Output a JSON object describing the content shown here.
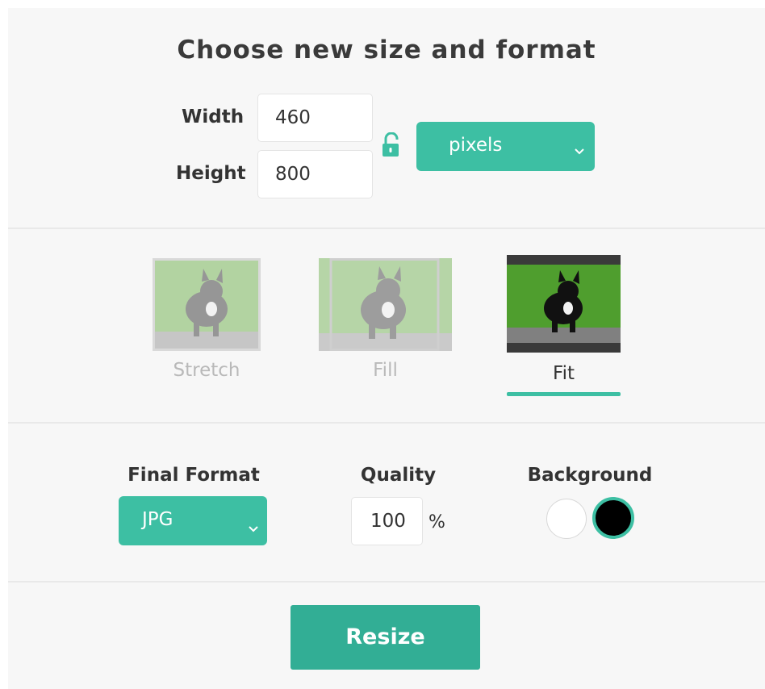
{
  "header": {
    "title": "Choose new size and format"
  },
  "dimensions": {
    "width_label": "Width",
    "width_value": "460",
    "height_label": "Height",
    "height_value": "800",
    "lock_icon": "unlocked-padlock",
    "unit_selected": "pixels"
  },
  "modes": {
    "items": [
      {
        "label": "Stretch",
        "selected": false
      },
      {
        "label": "Fill",
        "selected": false
      },
      {
        "label": "Fit",
        "selected": true
      }
    ]
  },
  "output": {
    "format_label": "Final Format",
    "format_selected": "JPG",
    "quality_label": "Quality",
    "quality_value": "100",
    "quality_unit": "%",
    "background_label": "Background",
    "background_options": [
      {
        "color": "#ffffff",
        "selected": false
      },
      {
        "color": "#000000",
        "selected": true
      }
    ]
  },
  "actions": {
    "resize_label": "Resize"
  },
  "colors": {
    "accent": "#3dbfa3",
    "button": "#32ae95",
    "panel": "#f7f7f7"
  }
}
